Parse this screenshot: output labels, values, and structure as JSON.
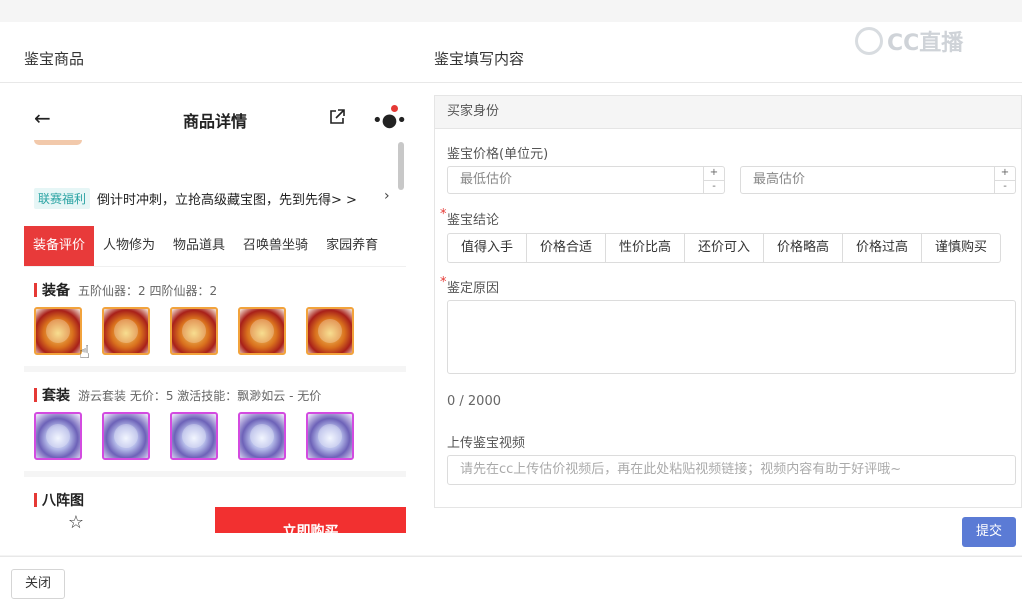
{
  "watermark": "CC直播",
  "left_title": "鉴宝商品",
  "right_title": "鉴宝填写内容",
  "phone": {
    "title": "商品详情",
    "promo_tag": "联赛福利",
    "promo_text": "倒计时冲刺，立抢高级藏宝图，先到先得> >",
    "tabs": [
      "装备评价",
      "人物修为",
      "物品道具",
      "召唤兽坐骑",
      "家园养育"
    ],
    "equipment_title": "装备",
    "equipment_meta": "五阶仙器：2  四阶仙器：2",
    "set_title": "套装",
    "set_meta": "游云套装  无价：5  激活技能：飘渺如云 - 无价",
    "formation_title": "八阵图",
    "favorite_label": "收藏",
    "buy_label": "立即购买"
  },
  "form": {
    "section_title": "买家身份",
    "price_label": "鉴宝价格(单位元)",
    "min_placeholder": "最低估价",
    "max_placeholder": "最高估价",
    "conclusion_label": "鉴宝结论",
    "conclusions": [
      "值得入手",
      "价格合适",
      "性价比高",
      "还价可入",
      "价格略高",
      "价格过高",
      "谨慎购买"
    ],
    "reason_label": "鉴定原因",
    "counter": "0 / 2000",
    "video_label": "上传鉴宝视频",
    "video_placeholder": "请先在cc上传估价视频后，再在此处粘贴视频链接；视频内容有助于好评哦~",
    "submit_label": "提交"
  },
  "close_label": "关闭"
}
